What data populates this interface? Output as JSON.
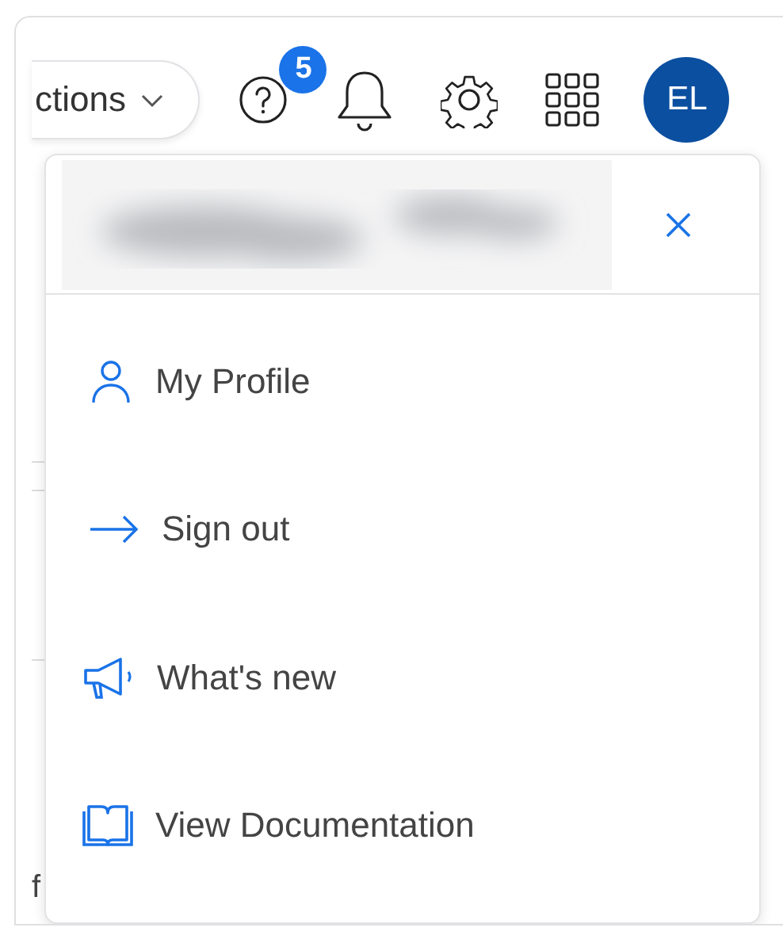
{
  "toolbar": {
    "menu_button": {
      "label": "ctions"
    },
    "help": {
      "badge": "5"
    },
    "avatar": {
      "initials": "EL"
    }
  },
  "account_menu": {
    "items": [
      {
        "kind": "profile",
        "label": "My Profile"
      },
      {
        "kind": "signout",
        "label": "Sign out"
      },
      {
        "kind": "news",
        "label": "What's new"
      },
      {
        "kind": "docs",
        "label": "View Documentation"
      }
    ]
  },
  "background": {
    "fragment": "f"
  }
}
